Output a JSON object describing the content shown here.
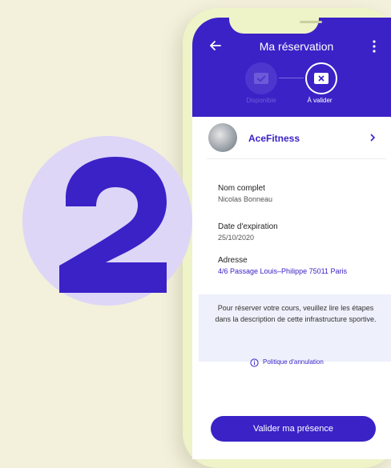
{
  "header": {
    "title": "Ma réservation"
  },
  "steps": [
    {
      "label": "Disponible"
    },
    {
      "label": "À valider"
    }
  ],
  "club": {
    "name": "AceFitness"
  },
  "fields": {
    "name_label": "Nom complet",
    "name_value": "Nicolas Bonneau",
    "expiration_label": "Date d'expiration",
    "expiration_value": "25/10/2020",
    "address_label": "Adresse",
    "address_value": "4/6 Passage Louis–Philippe 75011 Paris"
  },
  "info": {
    "text": "Pour réserver votre cours, veuillez lire les étapes dans la description de cette infrastructure sportive."
  },
  "policy": {
    "label": "Politique d'annulation"
  },
  "cta": {
    "label": "Valider ma présence"
  },
  "badge": {
    "number": "2"
  },
  "colors": {
    "primary": "#3a22c7",
    "background": "#f3f0dc",
    "badge": "#ddd6f6",
    "phone_frame": "#eef3c8"
  }
}
